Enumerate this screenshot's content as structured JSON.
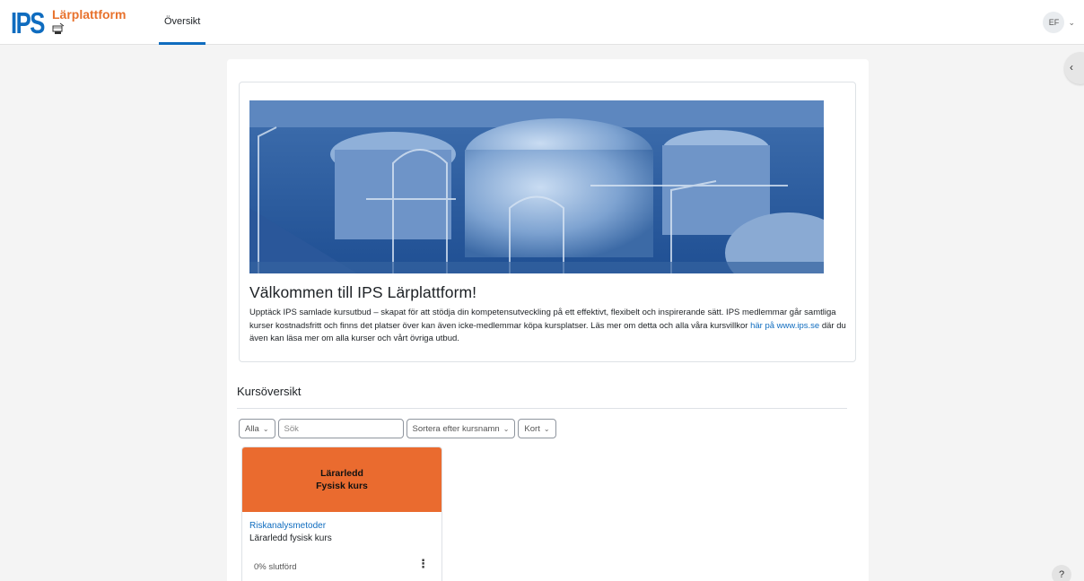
{
  "header": {
    "logo_text": "IPS",
    "site_title": "Lärplattform",
    "nav_tab": "Översikt",
    "user_initials": "EF"
  },
  "welcome": {
    "heading": "Välkommen till IPS Lärplattform!",
    "body_text": "Upptäck IPS samlade kursutbud – skapat för att stödja din kompetensutveckling på ett effektivt, flexibelt och inspirerande sätt. IPS medlemmar går samtliga kurser kostnadsfritt och finns det platser över kan även icke-medlemmar köpa kursplatser. Läs mer om detta och alla våra kursvillkor ",
    "link_text": "här på www.ips.se",
    "body_text_after": " där du även kan läsa mer om alla kurser och vårt övriga utbud."
  },
  "course_overview": {
    "title": "Kursöversikt",
    "filter_label": "Alla",
    "search_placeholder": "Sök",
    "sort_label": "Sortera efter kursnamn",
    "view_label": "Kort"
  },
  "course_card": {
    "image_line1": "Lärarledd",
    "image_line2": "Fysisk kurs",
    "course_name": "Riskanalysmetoder",
    "course_category": "Lärarledd fysisk kurs",
    "progress_percent": 0,
    "progress_text": "0% slutförd"
  },
  "colors": {
    "brand_blue": "#0f6cbf",
    "brand_orange": "#e8722d",
    "card_orange": "#ea6b2f"
  },
  "icons": {
    "drawer_toggle": "chevron-left-icon",
    "course_menu": "kebab-menu-icon",
    "help": "help-icon"
  }
}
